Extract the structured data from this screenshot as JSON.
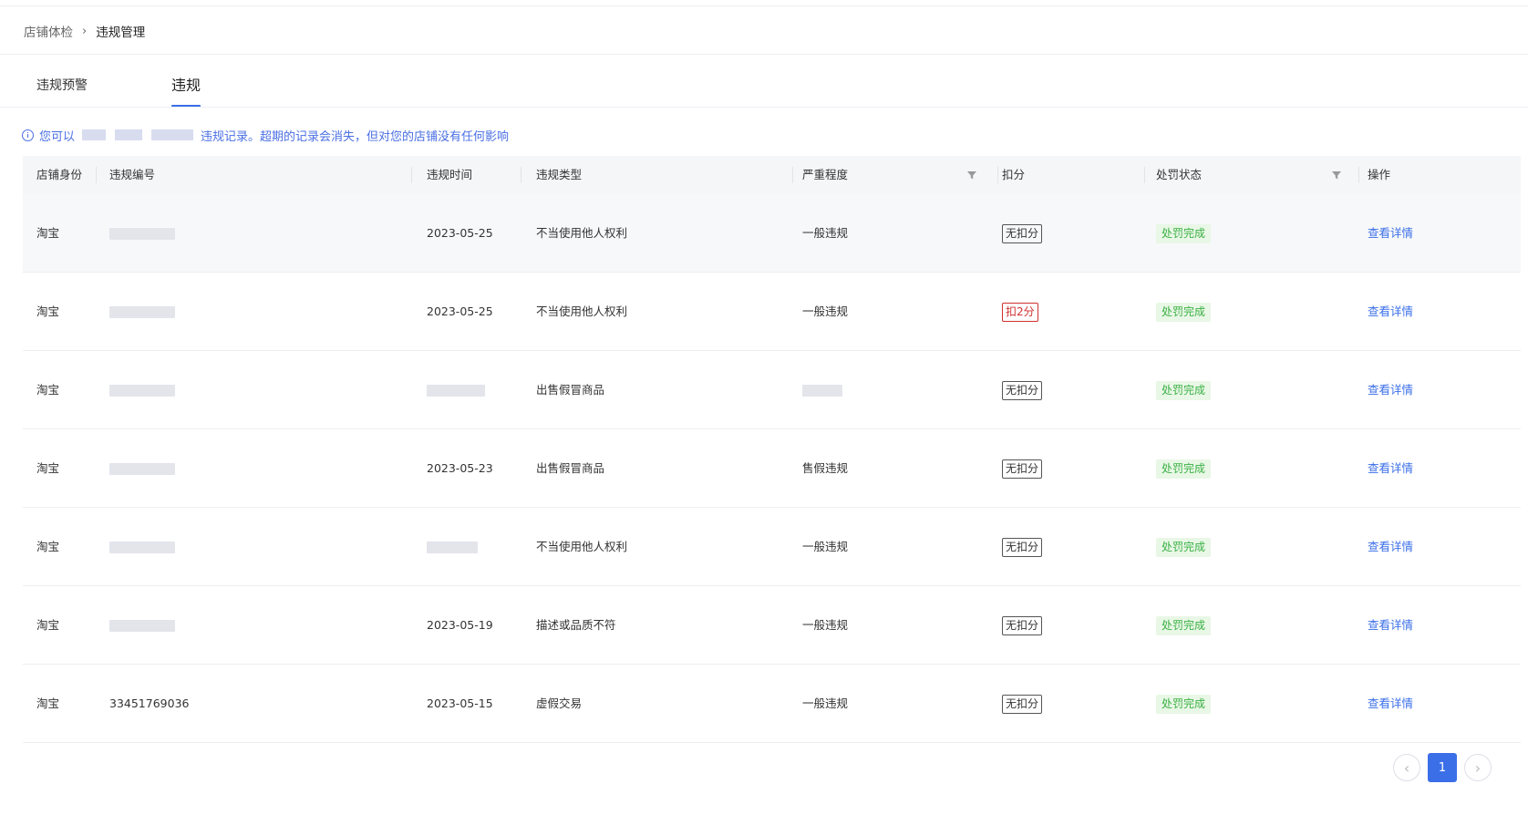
{
  "breadcrumb": {
    "parent": "店铺体检",
    "current": "违规管理"
  },
  "tabs": [
    {
      "label": "违规预警"
    },
    {
      "label": "违规",
      "active": true
    }
  ],
  "notice": {
    "prefix": "您可以",
    "text": "违规记录。超期的记录会消失，但对您的店铺没有任何影响"
  },
  "table": {
    "headers": [
      "店铺身份",
      "违规编号",
      "违规时间",
      "违规类型",
      "严重程度",
      "扣分",
      "处罚状态",
      "操作"
    ],
    "rows": [
      {
        "shop": "淘宝",
        "id": "",
        "time": "2023-05-25",
        "type": "不当使用他人权利",
        "severity": "一般违规",
        "score": "无扣分",
        "score_style": "normal",
        "status": "处罚完成",
        "action": "查看详情"
      },
      {
        "shop": "淘宝",
        "id": "",
        "time": "2023-05-25",
        "type": "不当使用他人权利",
        "severity": "一般违规",
        "score": "扣2分",
        "score_style": "red",
        "status": "处罚完成",
        "action": "查看详情"
      },
      {
        "shop": "淘宝",
        "id": "",
        "time": "",
        "type": "出售假冒商品",
        "severity": "",
        "score": "无扣分",
        "score_style": "normal",
        "status": "处罚完成",
        "action": "查看详情"
      },
      {
        "shop": "淘宝",
        "id": "",
        "time": "2023-05-23",
        "type": "出售假冒商品",
        "severity": "售假违规",
        "score": "无扣分",
        "score_style": "normal",
        "status": "处罚完成",
        "action": "查看详情"
      },
      {
        "shop": "淘宝",
        "id": "",
        "time": "",
        "type": "不当使用他人权利",
        "severity": "一般违规",
        "score": "无扣分",
        "score_style": "normal",
        "status": "处罚完成",
        "action": "查看详情"
      },
      {
        "shop": "淘宝",
        "id": "",
        "time": "2023-05-19",
        "type": "描述或品质不符",
        "severity": "一般违规",
        "score": "无扣分",
        "score_style": "normal",
        "status": "处罚完成",
        "action": "查看详情"
      },
      {
        "shop": "淘宝",
        "id": "33451769036",
        "time": "2023-05-15",
        "type": "虚假交易",
        "severity": "一般违规",
        "score": "无扣分",
        "score_style": "normal",
        "status": "处罚完成",
        "action": "查看详情"
      }
    ]
  },
  "pagination": {
    "current_page": "1",
    "prev_icon": "chevron-left-icon",
    "next_icon": "chevron-right-icon"
  },
  "colors": {
    "accent": "#3b6fe8",
    "success": "#3bb145",
    "danger": "#d0312d"
  }
}
